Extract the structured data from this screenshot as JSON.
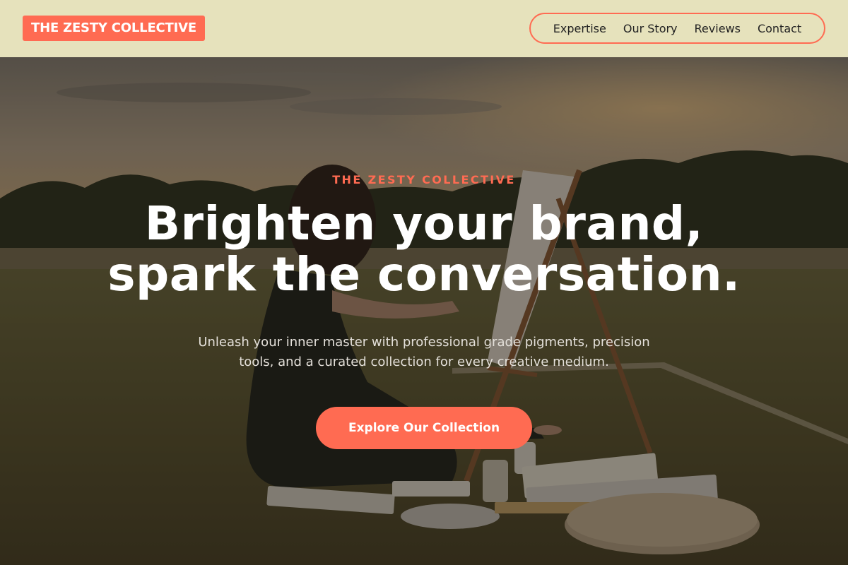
{
  "header": {
    "logo_text": "THE ZESTY COLLECTIVE",
    "nav": [
      {
        "label": "Expertise"
      },
      {
        "label": "Our Story"
      },
      {
        "label": "Reviews"
      },
      {
        "label": "Contact"
      }
    ]
  },
  "hero": {
    "eyebrow": "THE ZESTY COLLECTIVE",
    "headline_line1": "Brighten your brand,",
    "headline_line2": "spark the conversation.",
    "subtext": "Unleash your inner master with professional grade pigments, precision tools, and a curated collection for every creative medium.",
    "cta_label": "Explore Our Collection",
    "background_image": "woman painting at an easel on grass at sunset"
  },
  "colors": {
    "accent": "#ff6b52",
    "header_bg": "#e6e2bc",
    "heading_text": "#ffffff"
  }
}
